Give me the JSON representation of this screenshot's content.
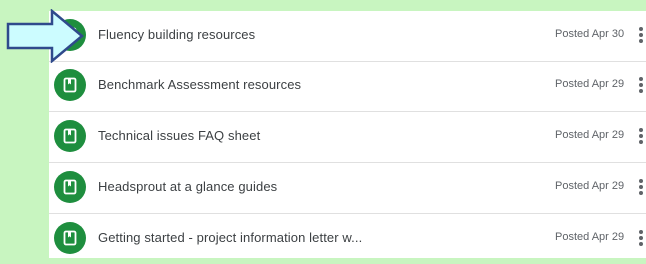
{
  "announcements": [
    {
      "title": "Fluency building resources",
      "date": "Posted Apr 30",
      "icon": "material-icon"
    },
    {
      "title": "Benchmark Assessment resources",
      "date": "Posted Apr 29",
      "icon": "material-icon"
    },
    {
      "title": "Technical issues FAQ sheet",
      "date": "Posted Apr 29",
      "icon": "material-icon"
    },
    {
      "title": "Headsprout at a glance guides",
      "date": "Posted Apr 29",
      "icon": "material-icon"
    },
    {
      "title": "Getting started - project information letter w...",
      "date": "Posted Apr 29",
      "icon": "material-icon"
    }
  ],
  "colors": {
    "background": "#c8f5c0",
    "icon_circle": "#1e8e3e",
    "arrow_fill": "#ccfcff",
    "arrow_stroke": "#2f4a8c"
  },
  "pointer": {
    "icon": "right-arrow-icon"
  }
}
